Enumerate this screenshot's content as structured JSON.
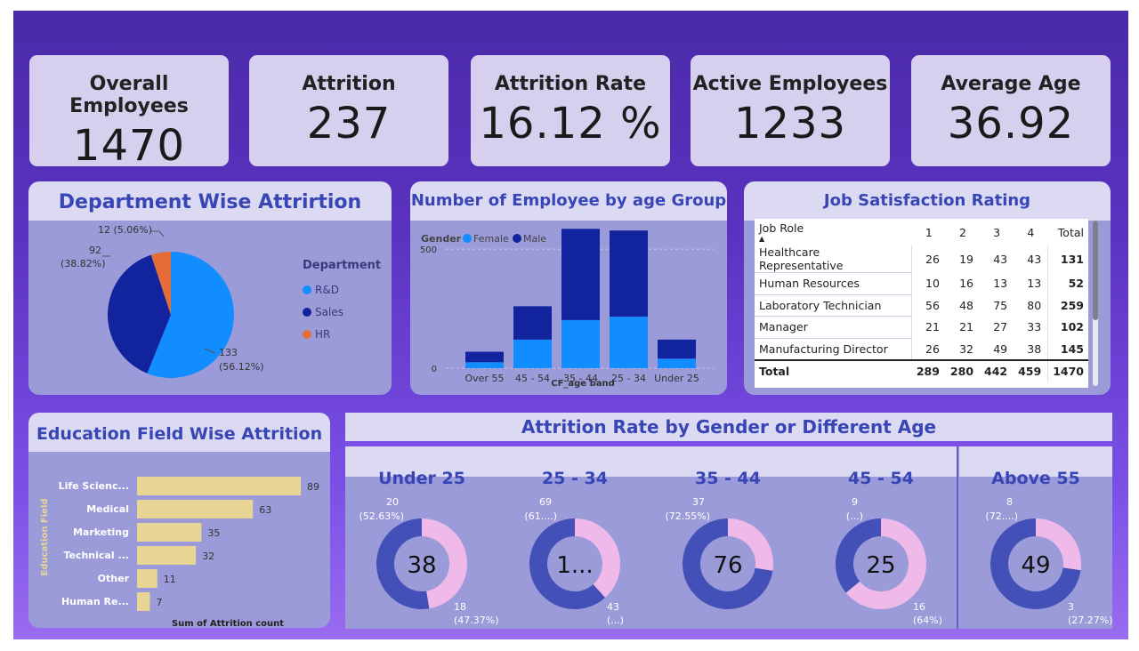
{
  "kpis": [
    {
      "label": "Overall Employees",
      "value": "1470"
    },
    {
      "label": "Attrition",
      "value": "237"
    },
    {
      "label": "Attrition Rate",
      "value": "16.12 %"
    },
    {
      "label": "Active Employees",
      "value": "1233"
    },
    {
      "label": "Average Age",
      "value": "36.92"
    }
  ],
  "dept": {
    "title": "Department Wise Attrirtion",
    "legend_title": "Department",
    "labels": [
      {
        "count": "12 (5.06%)",
        "pct": ""
      },
      {
        "count": "92",
        "pct": "(38.82%)"
      },
      {
        "count": "133",
        "pct": "(56.12%)"
      }
    ]
  },
  "age_chart": {
    "title": "Number of Employee by age Group",
    "legend_title": "Gender",
    "xlabel": "CF_age band"
  },
  "job": {
    "title": "Job Satisfaction Rating",
    "headers": [
      "Job Role",
      "1",
      "2",
      "3",
      "4",
      "Total"
    ],
    "rows": [
      [
        "Healthcare Representative",
        "26",
        "19",
        "43",
        "43",
        "131"
      ],
      [
        "Human Resources",
        "10",
        "16",
        "13",
        "13",
        "52"
      ],
      [
        "Laboratory Technician",
        "56",
        "48",
        "75",
        "80",
        "259"
      ],
      [
        "Manager",
        "21",
        "21",
        "27",
        "33",
        "102"
      ],
      [
        "Manufacturing Director",
        "26",
        "32",
        "49",
        "38",
        "145"
      ]
    ],
    "totals": [
      "Total",
      "289",
      "280",
      "442",
      "459",
      "1470"
    ]
  },
  "edu": {
    "title": "Education Field Wise Attrition",
    "ylabel": "Education Field",
    "xlabel": "Sum of Attrition count"
  },
  "gender_age": {
    "title": "Attrition Rate by Gender or Different Age",
    "groups": [
      {
        "name": "Under 25",
        "center": "38",
        "top_count": "20",
        "top_pct": "(52.63%)",
        "bot_count": "18",
        "bot_pct": "(47.37%)"
      },
      {
        "name": "25 - 34",
        "center": "1...",
        "top_count": "69",
        "top_pct": "(61....)",
        "bot_count": "43",
        "bot_pct": "(...)"
      },
      {
        "name": "35 - 44",
        "center": "76",
        "top_count": "37",
        "top_pct": "(72.55%)",
        "bot_count": "",
        "bot_pct": ""
      },
      {
        "name": "45 - 54",
        "center": "25",
        "top_count": "9",
        "top_pct": "(...)",
        "bot_count": "16",
        "bot_pct": "(64%)"
      },
      {
        "name": "Above 55",
        "center": "49",
        "top_count": "8",
        "top_pct": "(72....)",
        "bot_count": "3",
        "bot_pct": "(27.27%)"
      }
    ]
  },
  "colors": {
    "male": "#12239e",
    "female": "#118dff",
    "hr": "#e66c37",
    "bar": "#e8d595",
    "donut_male": "#4250b8",
    "donut_female": "#efb9e9"
  },
  "chart_data": [
    {
      "type": "pie",
      "title": "Department Wise Attrirtion",
      "legend_title": "Department",
      "categories": [
        "R&D",
        "Sales",
        "HR"
      ],
      "values": [
        133,
        92,
        12
      ],
      "percent": [
        56.12,
        38.82,
        5.06
      ],
      "legend": "right"
    },
    {
      "type": "bar",
      "title": "Number of Employee by age Group",
      "xlabel": "CF_age band",
      "legend": "top-left",
      "stacked": true,
      "categories": [
        "Over 55",
        "45 - 54",
        "35 - 44",
        "25 - 34",
        "Under 25"
      ],
      "ylim": [
        0,
        560
      ],
      "yticks": [
        0,
        500
      ],
      "series": [
        {
          "name": "Female",
          "values": [
            25,
            120,
            202,
            216,
            40
          ]
        },
        {
          "name": "Male",
          "values": [
            44,
            140,
            383,
            362,
            80
          ]
        }
      ]
    },
    {
      "type": "bar",
      "orientation": "horizontal",
      "title": "Education Field Wise Attrition",
      "xlabel": "Sum of Attrition count",
      "ylabel": "Education Field",
      "categories": [
        "Life Scienc...",
        "Medical",
        "Marketing",
        "Technical ...",
        "Other",
        "Human Re..."
      ],
      "values": [
        89,
        63,
        35,
        32,
        11,
        7
      ]
    },
    {
      "type": "pie",
      "donut": true,
      "title": "Attrition Rate by Gender or Different Age",
      "categories": [
        "Under 25",
        "25 - 34",
        "35 - 44",
        "45 - 54",
        "Above 55"
      ],
      "series": [
        {
          "values": [
            20,
            69,
            37,
            9,
            8
          ]
        },
        {
          "values": [
            18,
            43,
            14,
            16,
            3
          ]
        }
      ]
    }
  ]
}
